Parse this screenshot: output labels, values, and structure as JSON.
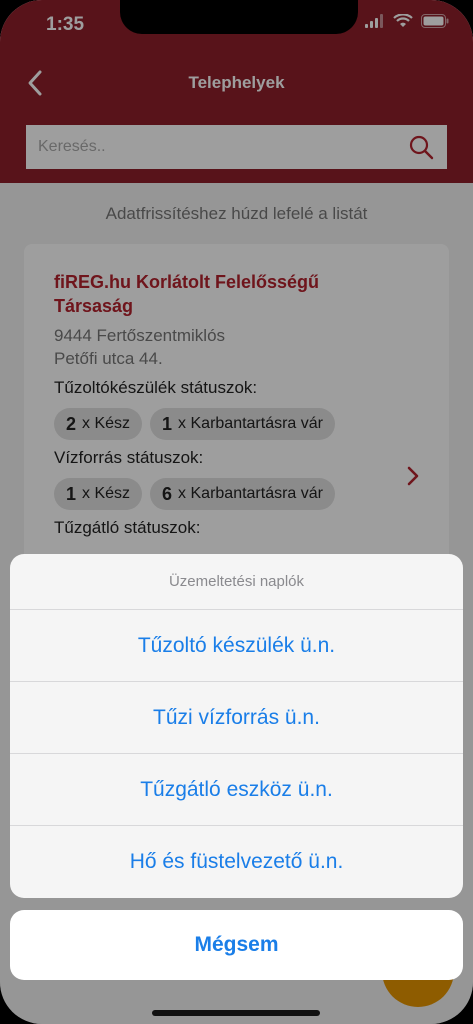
{
  "status": {
    "time": "1:35"
  },
  "nav": {
    "title": "Telephelyek"
  },
  "search": {
    "placeholder": "Keresés.."
  },
  "hint": "Adatfrissítéshez húzd lefelé a listát",
  "card": {
    "company": "fiREG.hu Korlátolt Felelősségű Társaság",
    "address_line1": "9444 Fertőszentmiklós",
    "address_line2": "Petőfi utca 44.",
    "sections": [
      {
        "label": "Tűzoltókészülék státuszok:",
        "chips": [
          {
            "count": "2",
            "text": "x Kész"
          },
          {
            "count": "1",
            "text": "x Karbantartásra vár"
          }
        ]
      },
      {
        "label": "Vízforrás státuszok:",
        "chips": [
          {
            "count": "1",
            "text": "x Kész"
          },
          {
            "count": "6",
            "text": "x Karbantartásra vár"
          }
        ]
      },
      {
        "label": "Tűzgátló státuszok:"
      }
    ]
  },
  "sheet": {
    "title": "Üzemeltetési naplók",
    "items": [
      "Tűzoltó készülék ü.n.",
      "Tűzi vízforrás ü.n.",
      "Tűzgátló eszköz ü.n.",
      "Hő és füstelvezető ü.n."
    ],
    "cancel": "Mégsem"
  },
  "colors": {
    "brand": "#8e1f2a",
    "accent": "#1a7ee8",
    "fab": "#e69500"
  }
}
